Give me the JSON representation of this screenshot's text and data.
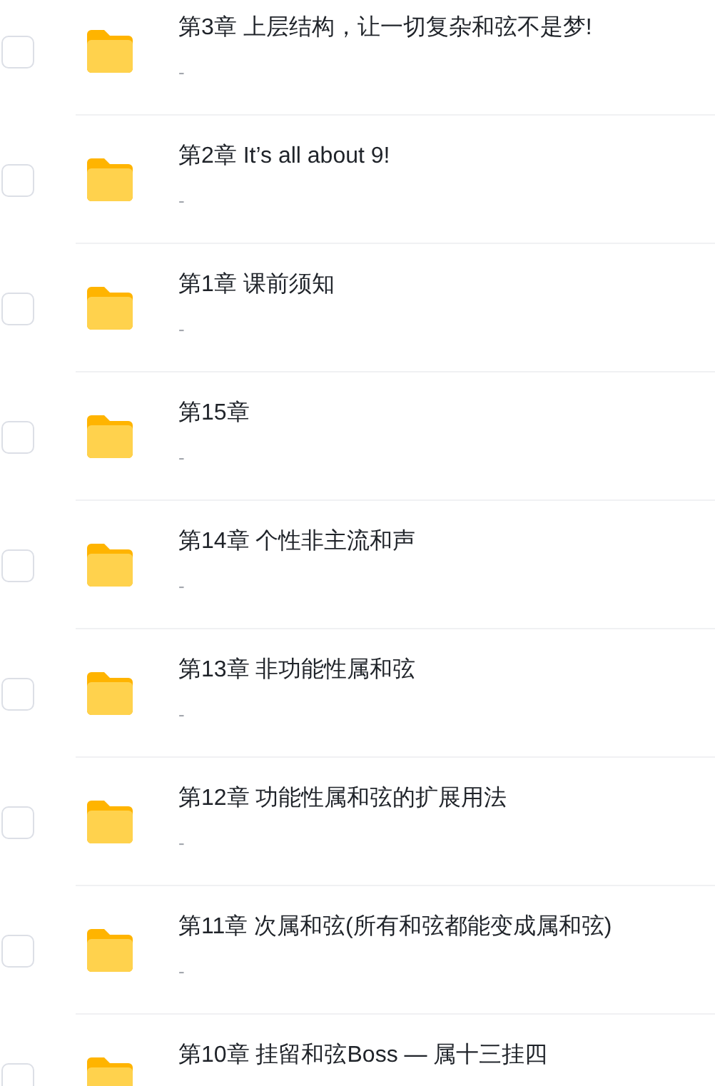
{
  "folders": [
    {
      "title": "第3章 上层结构，让一切复杂和弦不是梦!",
      "subtitle": "-",
      "checked": false
    },
    {
      "title": "第2章 It’s all about 9!",
      "subtitle": "-",
      "checked": false
    },
    {
      "title": "第1章 课前须知",
      "subtitle": "-",
      "checked": false
    },
    {
      "title": "第15章",
      "subtitle": "-",
      "checked": false
    },
    {
      "title": "第14章 个性非主流和声",
      "subtitle": "-",
      "checked": false
    },
    {
      "title": "第13章 非功能性属和弦",
      "subtitle": "-",
      "checked": false
    },
    {
      "title": "第12章 功能性属和弦的扩展用法",
      "subtitle": "-",
      "checked": false
    },
    {
      "title": "第11章 次属和弦(所有和弦都能变成属和弦)",
      "subtitle": "-",
      "checked": false
    },
    {
      "title": "第10章 挂留和弦Boss — 属十三挂四",
      "checked": false
    }
  ]
}
